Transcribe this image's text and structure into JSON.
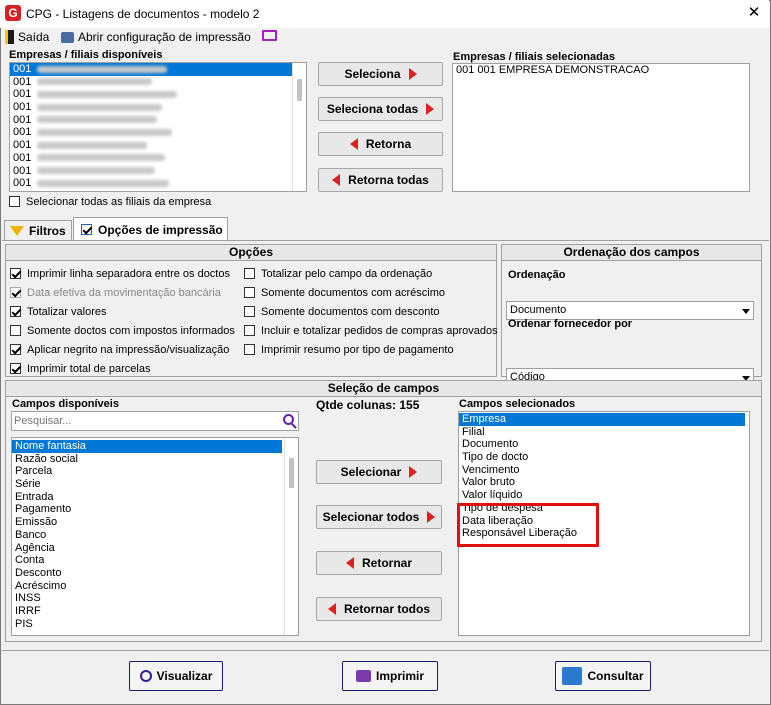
{
  "window": {
    "title": "CPG - Listagens de documentos - modelo 2",
    "close": "✕"
  },
  "toolbar": {
    "exit": "Saída",
    "open_config": "Abrir configuração de impressão"
  },
  "companies": {
    "available_label": "Empresas / filiais disponíveis",
    "available": [
      "001",
      "001",
      "001",
      "001",
      "001",
      "001",
      "001",
      "001",
      "001",
      "001"
    ],
    "selected_label": "Empresas / filiais selecionadas",
    "selected": [
      "001 001 EMPRESA DEMONSTRACAO"
    ],
    "select_all_branches": "Selecionar todas as filiais da empresa"
  },
  "buttons": {
    "select": "Seleciona",
    "select_all": "Seleciona todas",
    "return": "Retorna",
    "return_all": "Retorna todas"
  },
  "tabs": {
    "filters": "Filtros",
    "print_options": "Opções de impressão"
  },
  "options": {
    "title": "Opções",
    "left": [
      {
        "label": "Imprimir linha separadora entre os doctos",
        "checked": true,
        "disabled": false
      },
      {
        "label": "Data efetiva da movimentação bancária",
        "checked": true,
        "disabled": true
      },
      {
        "label": "Totalizar valores",
        "checked": true,
        "disabled": false
      },
      {
        "label": "Somente doctos com impostos informados",
        "checked": false,
        "disabled": false
      },
      {
        "label": "Aplicar negrito na impressão/visualização",
        "checked": true,
        "disabled": false
      },
      {
        "label": "Imprimir total de parcelas",
        "checked": true,
        "disabled": false
      }
    ],
    "right": [
      {
        "label": "Totalizar pelo campo da ordenação",
        "checked": false
      },
      {
        "label": "Somente documentos com acréscimo",
        "checked": false
      },
      {
        "label": "Somente documentos com desconto",
        "checked": false
      },
      {
        "label": "Incluir e totalizar pedidos de compras aprovados",
        "checked": false
      },
      {
        "label": "Imprimir resumo por tipo de pagamento",
        "checked": false
      }
    ]
  },
  "ordering": {
    "title": "Ordenação dos campos",
    "order_label": "Ordenação",
    "order_value": "Documento",
    "supplier_label": "Ordenar fornecedor por",
    "supplier_value": "Código"
  },
  "fields": {
    "title": "Seleção de campos",
    "available_label": "Campos disponíveis",
    "search_placeholder": "Pesquisar...",
    "qty_label": "Qtde colunas: 155",
    "available": [
      "Nome fantasia",
      "Razão social",
      "Parcela",
      "Série",
      "Entrada",
      "Pagamento",
      "Emissão",
      "Banco",
      "Agência",
      "Conta",
      "Desconto",
      "Acréscimo",
      "INSS",
      "IRRF",
      "PIS"
    ],
    "selected_label": "Campos selecionados",
    "selected": [
      "Empresa",
      "Filial",
      "Documento",
      "Tipo de docto",
      "Vencimento",
      "Valor bruto",
      "Valor líquido",
      "Tipo de despesa",
      "Data liberação",
      "Responsável Liberação"
    ],
    "btn_select": "Selecionar",
    "btn_select_all": "Selecionar todos",
    "btn_return": "Retornar",
    "btn_return_all": "Retornar todos"
  },
  "footer": {
    "view": "Visualizar",
    "print": "Imprimir",
    "query": "Consultar"
  },
  "colors": {
    "selection": "#0078d7",
    "highlight_box": "#e01010",
    "accent_red": "#e02020"
  }
}
